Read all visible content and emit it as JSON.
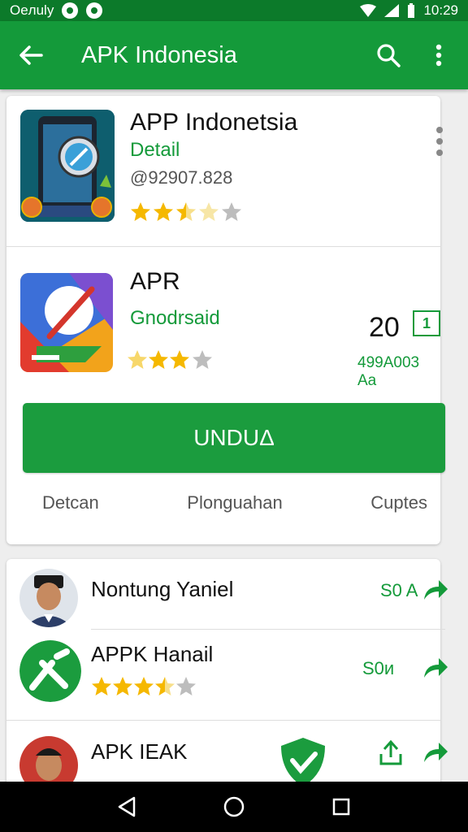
{
  "status_bar": {
    "carrier": "Oeлuly",
    "time": "10:29"
  },
  "app_bar": {
    "title": "APK Indonesia"
  },
  "featured": {
    "name": "APP Indonetsia",
    "subtitle": "Detail",
    "meta": "@92907.828",
    "rating": 3.5
  },
  "app_detail": {
    "name": "APR",
    "subtitle": "Gnodrsaid",
    "rating": 3,
    "count": "20",
    "count_box": "1",
    "size": "499A003 Aa",
    "download_label": "UNDUΔ",
    "tabs": [
      "Detcan",
      "Plonguahan",
      "Cuptes"
    ]
  },
  "list": [
    {
      "name": "Nontung Yaniel",
      "meta": "S0 A"
    },
    {
      "name": "APPK Hanail",
      "meta": "S0и",
      "rating": 3.5
    },
    {
      "name": "APK IEAK"
    }
  ],
  "colors": {
    "primary": "#149a3a",
    "primary_dark": "#0c7a2a",
    "star": "#f5b800"
  }
}
